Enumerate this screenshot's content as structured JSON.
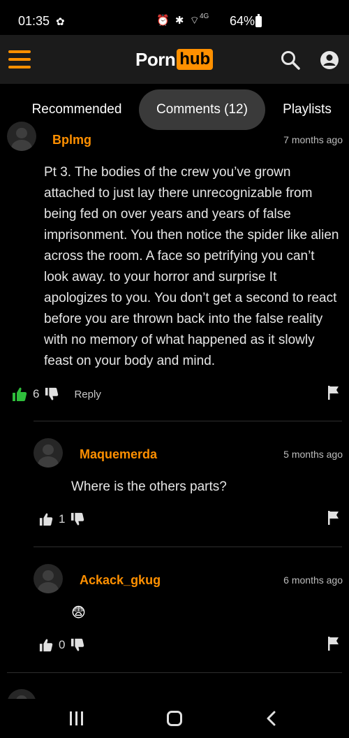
{
  "status_bar": {
    "time": "01:35",
    "network_label": "4G",
    "battery": "64%"
  },
  "header": {
    "logo_part1": "Porn",
    "logo_part2": "hub",
    "brand_color": "#ff9000"
  },
  "tabs": [
    {
      "label": "Recommended"
    },
    {
      "label": "Comments (12)"
    },
    {
      "label": "Playlists"
    }
  ],
  "comments": [
    {
      "username": "Bplmg",
      "time": "7 months ago",
      "text": "Pt 3. The bodies of the crew you’ve grown attached to just lay there unrecognizable from being fed on over years and years of false imprisonment. You then notice the spider like alien across the room. A face so petrifying you can’t look away. to your horror and surprise It apologizes to you. You don’t get a second to react before you are thrown back into the false reality with no memory of what happened as it slowly feast on your body and mind.",
      "likes": "6",
      "reply_label": "Reply",
      "liked": true
    },
    {
      "username": "Maquemerda",
      "time": "5 months ago",
      "text": "Where is the others parts?",
      "likes": "1"
    },
    {
      "username": "Ackack_gkug",
      "time": "6 months ago",
      "text": "😨",
      "likes": "0"
    }
  ],
  "icons": {
    "hamburger": "menu-icon",
    "search": "search-icon",
    "user": "user-icon",
    "thumb_up": "thumb-up-icon",
    "thumb_down": "thumb-down-icon",
    "flag": "flag-icon"
  },
  "colors": {
    "accent": "#ff9000",
    "liked": "#2fbe3c",
    "header_bg": "#1b1b1b",
    "tab_active_bg": "#3a3a3a"
  }
}
